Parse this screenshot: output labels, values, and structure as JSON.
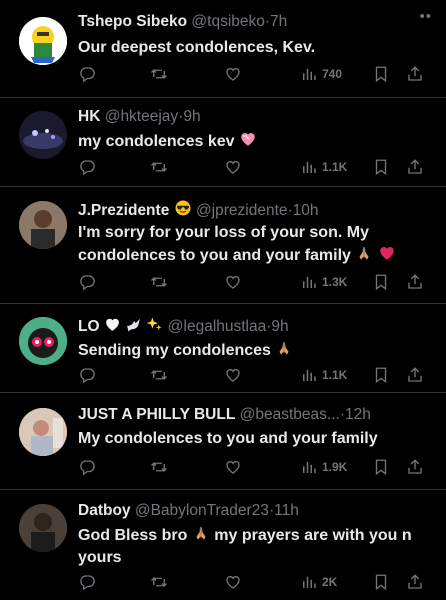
{
  "tweets": [
    {
      "name": "Tshepo Sibeko",
      "handle": "@tqsibeko",
      "time": "7h",
      "text": "Our deepest condolences, Kev.",
      "views": "740"
    },
    {
      "name": "HK",
      "handle": "@hkteejay",
      "time": "9h",
      "text": "my condolences kev",
      "views": "1.1K"
    },
    {
      "name": "J.Prezidente",
      "handle": "@jprezidente",
      "time": "10h",
      "text": "I'm sorry for your loss of your son. My condolences to you and your family",
      "views": "1.3K"
    },
    {
      "name": "LO",
      "handle": "@legalhustlaa",
      "time": "9h",
      "text": "Sending my condolences",
      "views": "1.1K"
    },
    {
      "name": "JUST A PHILLY BULL",
      "handle": "@beastbeas...",
      "time": "12h",
      "text": "My condolences to you and your family",
      "views": "1.9K"
    },
    {
      "name": "Datboy",
      "handle": "@BabylonTrader23",
      "time": "11h",
      "text": "God Bless bro",
      "text2": "my prayers are with you n yours",
      "views": "2K"
    }
  ],
  "separator": "·",
  "icons": [
    "reply-icon",
    "retweet-icon",
    "like-icon",
    "views-icon",
    "bookmark-icon",
    "share-icon"
  ],
  "colors": {
    "background": "#000000",
    "text": "#e7e9ea",
    "muted": "#71767b",
    "divider": "#2f3336"
  }
}
